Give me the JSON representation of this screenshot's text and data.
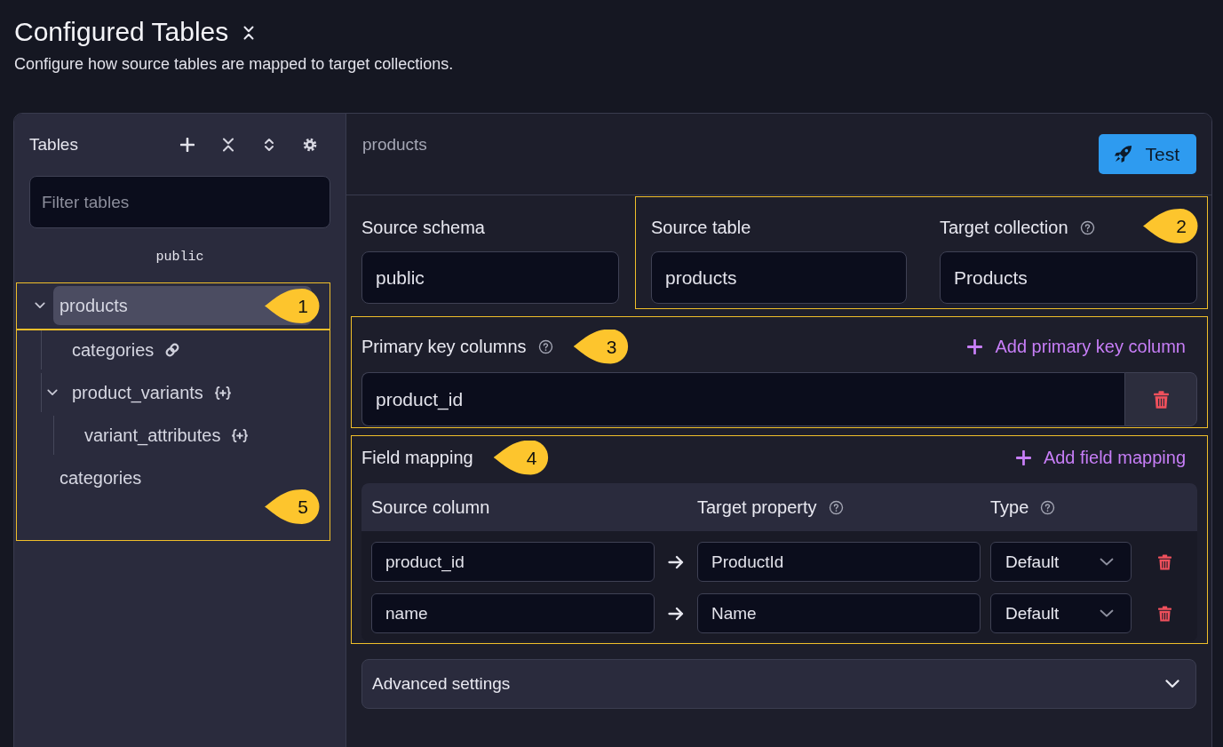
{
  "page": {
    "title": "Configured Tables",
    "subtitle": "Configure how source tables are mapped to target collections."
  },
  "sidebar": {
    "title": "Tables",
    "filter": {
      "placeholder": "Filter tables"
    },
    "schema": "public",
    "tree": [
      {
        "label": "products",
        "selected": true,
        "expanded": true,
        "callout": "1",
        "children": [
          {
            "label": "categories",
            "kind": "reference",
            "selected": false
          },
          {
            "label": "product_variants",
            "kind": "embedded",
            "selected": false,
            "expanded": true,
            "children": [
              {
                "label": "variant_attributes",
                "kind": "embedded",
                "selected": false
              }
            ]
          }
        ]
      },
      {
        "label": "categories",
        "selected": false
      }
    ],
    "tree_callout": "5"
  },
  "detail": {
    "title": "products",
    "test_button": "Test",
    "source_schema": {
      "label": "Source schema",
      "value": "public",
      "help": false
    },
    "mapping_target": {
      "callout": "2",
      "fields": [
        {
          "label": "Source table",
          "value": "products",
          "help": false
        },
        {
          "label": "Target collection",
          "value": "Products",
          "help": true
        }
      ]
    },
    "primary_key": {
      "label": "Primary key columns",
      "help": true,
      "callout": "3",
      "add_button": "Add primary key column",
      "columns": [
        "product_id"
      ]
    },
    "field_mapping": {
      "label": "Field mapping",
      "callout": "4",
      "add_button": "Add field mapping",
      "columns": [
        {
          "label": "Source column",
          "help": false
        },
        {
          "label": "Target property",
          "help": true
        },
        {
          "label": "Type",
          "help": true
        }
      ],
      "rows": [
        {
          "source": "product_id",
          "target": "ProductId",
          "type": "Default"
        },
        {
          "source": "name",
          "target": "Name",
          "type": "Default"
        }
      ]
    },
    "advanced_settings": {
      "label": "Advanced settings",
      "expanded": false
    }
  }
}
